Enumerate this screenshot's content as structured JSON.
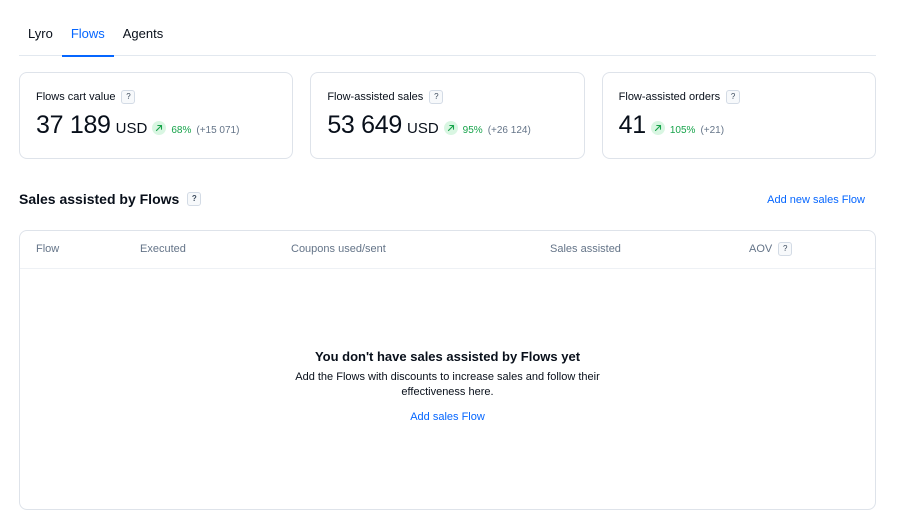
{
  "tabs": [
    {
      "label": "Lyro",
      "active": false
    },
    {
      "label": "Flows",
      "active": true
    },
    {
      "label": "Agents",
      "active": false
    }
  ],
  "cards": [
    {
      "label": "Flows cart value",
      "help": "?",
      "value": "37 189",
      "unit": "USD",
      "pct": "68%",
      "delta": "(+15 071)"
    },
    {
      "label": "Flow-assisted sales",
      "help": "?",
      "value": "53 649",
      "unit": "USD",
      "pct": "95%",
      "delta": "(+26 124)"
    },
    {
      "label": "Flow-assisted orders",
      "help": "?",
      "value": "41",
      "unit": "",
      "pct": "105%",
      "delta": "(+21)"
    }
  ],
  "section": {
    "title": "Sales assisted by Flows",
    "help": "?",
    "add_link": "Add new sales Flow"
  },
  "table": {
    "columns": [
      "Flow",
      "Executed",
      "Coupons used/sent",
      "Sales assisted",
      "AOV"
    ],
    "aov_help": "?",
    "empty_title": "You don't have sales assisted by Flows yet",
    "empty_desc": "Add the Flows with discounts to increase sales and follow their effectiveness here.",
    "empty_link": "Add sales Flow"
  },
  "colors": {
    "accent": "#0566ff",
    "positive": "#16a34a",
    "positive_bg": "#d9f6e2"
  }
}
